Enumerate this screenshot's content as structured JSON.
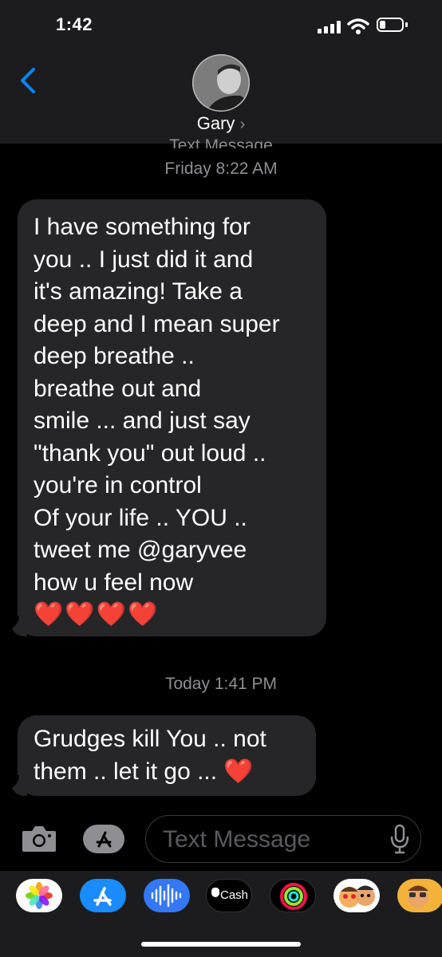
{
  "status_bar": {
    "time": "1:42"
  },
  "header": {
    "contact_name": "Gary"
  },
  "messages": [
    {
      "timestamp_partial": "Text Message",
      "timestamp": "Friday 8:22 AM",
      "lines": [
        "I have something for",
        "you .. I just did it and",
        "it's amazing! Take a",
        "deep and I mean super",
        "deep breathe ..",
        "breathe out and",
        "smile ... and just say",
        "\"thank you\" out loud ..",
        "you're in control",
        "Of your life .. YOU ..",
        "tweet me @garyvee",
        "how u feel now"
      ],
      "emoji": "❤️❤️❤️❤️"
    },
    {
      "timestamp": "Today 1:41 PM",
      "lines": [
        "Grudges kill You .. not",
        "them .. let it go ... ❤️"
      ]
    }
  ],
  "input": {
    "placeholder": "Text Message"
  },
  "app_drawer": {
    "apps": [
      "photos-icon",
      "app-store-icon",
      "audio-icon",
      "cash-icon",
      "activity-icon",
      "memoji-icon",
      "memoji-2-icon"
    ],
    "cash_label": "Cash"
  },
  "colors": {
    "accent": "#0a84ff",
    "bubble": "#262628",
    "background": "#000000",
    "header": "#1c1c1e"
  }
}
